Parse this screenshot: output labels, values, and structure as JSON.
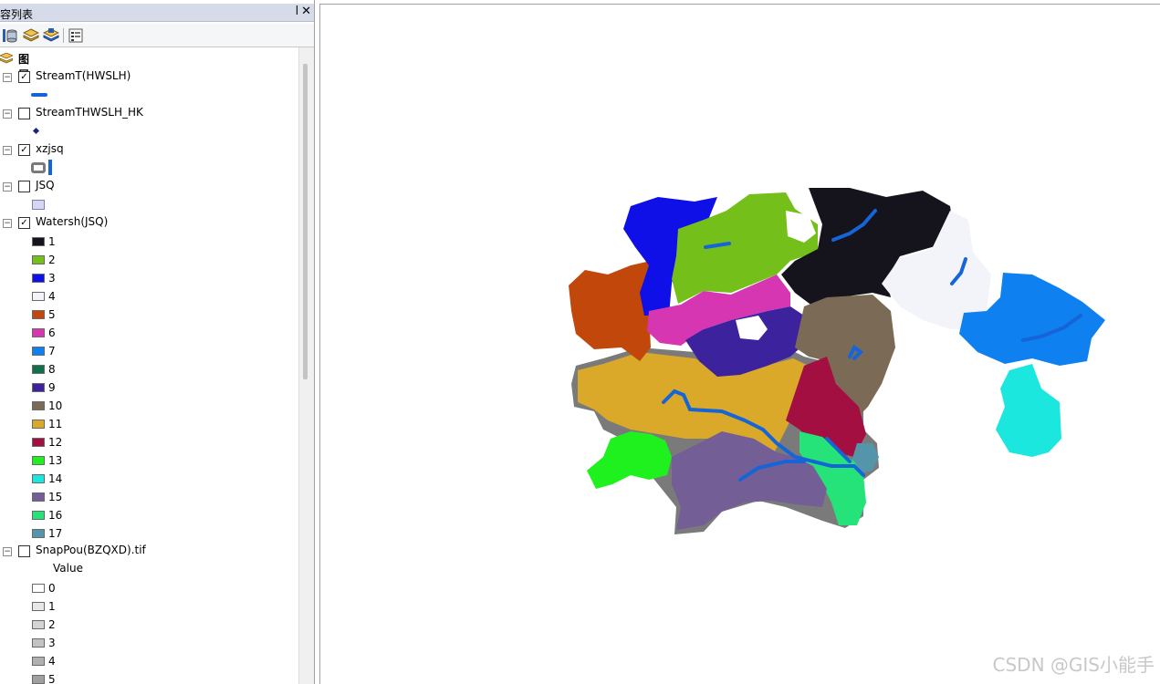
{
  "panel": {
    "title": "容列表",
    "pin_glyph": "ꟾ",
    "close_glyph": "✕",
    "root_label": "图层"
  },
  "toolbar": {
    "buttons": [
      "list-by-drawing-order-icon",
      "list-by-source-icon",
      "list-by-visibility-icon",
      "list-by-selection-icon",
      "options-icon"
    ]
  },
  "layers": [
    {
      "name": "StreamT(HWSLH)",
      "checked": true,
      "expanded": true,
      "symbol": "line",
      "color": "#1565d8"
    },
    {
      "name": "StreamTHWSLH_HK",
      "checked": false,
      "expanded": true,
      "symbol": "point",
      "color": "#1a237e"
    },
    {
      "name": "xzjsq",
      "checked": true,
      "expanded": true,
      "symbol": "hollow-rect",
      "color": "#7a7a7a"
    },
    {
      "name": "JSQ",
      "checked": false,
      "expanded": true,
      "symbol": "fill",
      "color": "#d6d6f2"
    },
    {
      "name": "Watersh(JSQ)",
      "checked": true,
      "expanded": true,
      "symbol": "classes"
    },
    {
      "name": "SnapPou(BZQXD).tif",
      "checked": false,
      "expanded": true,
      "symbol": "raster"
    }
  ],
  "watershed_classes": [
    {
      "label": "1",
      "color": "#15131c"
    },
    {
      "label": "2",
      "color": "#74bf19"
    },
    {
      "label": "3",
      "color": "#0f0fe8"
    },
    {
      "label": "4",
      "color": "#f2f4f9"
    },
    {
      "label": "5",
      "color": "#c1470a"
    },
    {
      "label": "6",
      "color": "#d636b1"
    },
    {
      "label": "7",
      "color": "#0f80ef"
    },
    {
      "label": "8",
      "color": "#11704a"
    },
    {
      "label": "9",
      "color": "#3d229e"
    },
    {
      "label": "10",
      "color": "#7a6a56"
    },
    {
      "label": "11",
      "color": "#dba929"
    },
    {
      "label": "12",
      "color": "#a30f40"
    },
    {
      "label": "13",
      "color": "#1ef11e"
    },
    {
      "label": "14",
      "color": "#1ce7df"
    },
    {
      "label": "15",
      "color": "#735e96"
    },
    {
      "label": "16",
      "color": "#25e378"
    },
    {
      "label": "17",
      "color": "#5495a9"
    }
  ],
  "snap_header": "Value",
  "snap_values": [
    {
      "label": "0",
      "color": "#ffffff"
    },
    {
      "label": "1",
      "color": "#e8e8e8"
    },
    {
      "label": "2",
      "color": "#d4d4d4"
    },
    {
      "label": "3",
      "color": "#c3c3c3"
    },
    {
      "label": "4",
      "color": "#b0b0b0"
    },
    {
      "label": "5",
      "color": "#a0a0a0"
    }
  ],
  "watermark": "CSDN @GIS小能手"
}
